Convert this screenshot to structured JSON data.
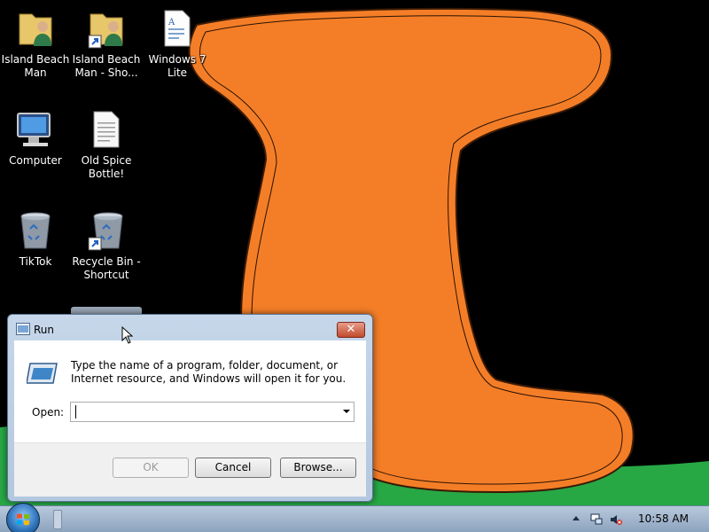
{
  "desktop": {
    "icons": [
      {
        "label": "Island Beach Man",
        "icon": "user-folder-icon"
      },
      {
        "label": "Island Beach Man - Sho...",
        "icon": "user-folder-shortcut-icon"
      },
      {
        "label": "Windows 7 Lite",
        "icon": "document-icon"
      },
      {
        "label": "Computer",
        "icon": "computer-icon"
      },
      {
        "label": "Old Spice Bottle!",
        "icon": "text-file-icon"
      },
      {
        "label": "TikTok",
        "icon": "recycle-bin-icon"
      },
      {
        "label": "Recycle Bin - Shortcut",
        "icon": "recycle-bin-shortcut-icon"
      }
    ]
  },
  "run_dialog": {
    "title": "Run",
    "close_label": "✕",
    "description": "Type the name of a program, folder, document, or Internet resource, and Windows will open it for you.",
    "open_label": "Open:",
    "open_value": "",
    "ok_label": "OK",
    "cancel_label": "Cancel",
    "browse_label": "Browse..."
  },
  "taskbar": {
    "clock": "10:58 AM"
  },
  "colors": {
    "blob_orange": "#f47e27",
    "grass_green": "#27a845",
    "desktop_black": "#000000"
  }
}
